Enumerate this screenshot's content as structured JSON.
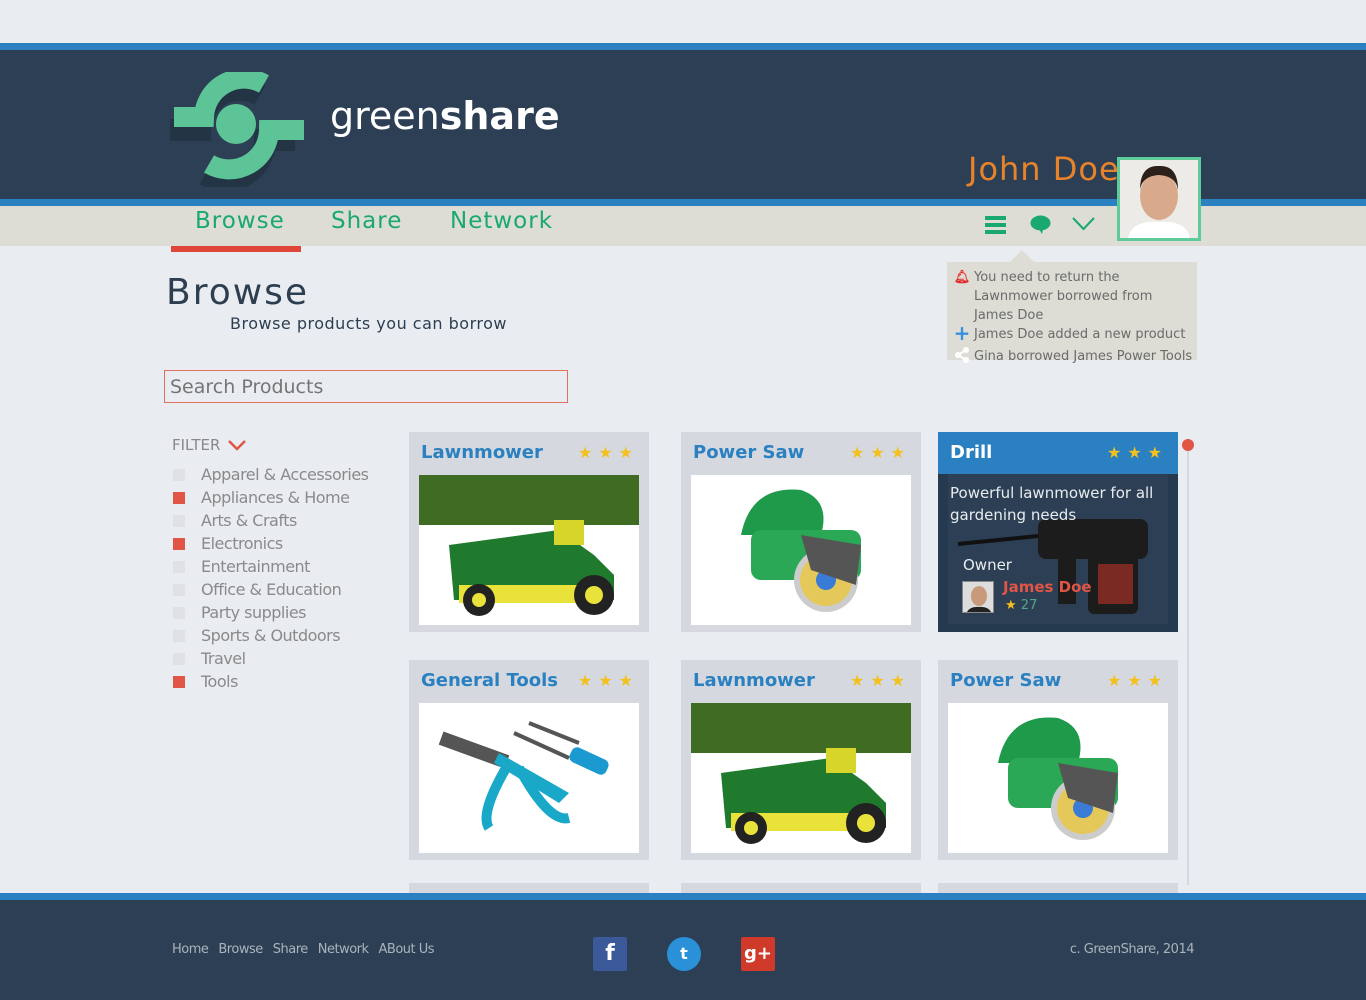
{
  "brand": {
    "name_light": "green",
    "name_bold": "share"
  },
  "user": {
    "name": "John Doe"
  },
  "nav": {
    "tabs": [
      {
        "label": "Browse",
        "active": true
      },
      {
        "label": "Share"
      },
      {
        "label": "Network"
      }
    ]
  },
  "notifications": [
    {
      "icon": "bell-icon",
      "text": "You need to return the Lawnmower borrowed from James Doe"
    },
    {
      "icon": "plus-icon",
      "text": "James Doe added a new product"
    },
    {
      "icon": "share-icon",
      "text": "Gina borrowed James Power Tools"
    }
  ],
  "page": {
    "title": "Browse",
    "subtitle": "Browse products you can borrow"
  },
  "search": {
    "placeholder": "Search Products",
    "value": ""
  },
  "filter": {
    "label": "FILTER",
    "items": [
      {
        "label": "Apparel & Accessories",
        "checked": false
      },
      {
        "label": "Appliances & Home",
        "checked": true
      },
      {
        "label": "Arts & Crafts",
        "checked": false
      },
      {
        "label": "Electronics",
        "checked": true
      },
      {
        "label": "Entertainment",
        "checked": false
      },
      {
        "label": "Office & Education",
        "checked": false
      },
      {
        "label": "Party supplies",
        "checked": false
      },
      {
        "label": "Sports & Outdoors",
        "checked": false
      },
      {
        "label": "Travel",
        "checked": false
      },
      {
        "label": "Tools",
        "checked": true
      }
    ]
  },
  "products": [
    {
      "title": "Lawnmower",
      "stars": "★★★",
      "image": "lawnmower"
    },
    {
      "title": "Power Saw",
      "stars": "★★★",
      "image": "saw"
    },
    {
      "title": "Drill",
      "stars": "★★★",
      "image": "drill",
      "description": "Powerful lawnmower for all gardening needs",
      "owner_label": "Owner",
      "owner": "James Doe",
      "owner_rating": "27"
    },
    {
      "title": "General Tools",
      "stars": "★★★",
      "image": "tools"
    },
    {
      "title": "Lawnmower",
      "stars": "★★★",
      "image": "lawnmower"
    },
    {
      "title": "Power Saw",
      "stars": "★★★",
      "image": "saw"
    }
  ],
  "footer": {
    "links": [
      "Home",
      "Browse",
      "Share",
      "Network",
      "ABout Us"
    ],
    "social": [
      "f",
      "t",
      "g+"
    ],
    "copyright": "c. GreenShare, 2014"
  }
}
